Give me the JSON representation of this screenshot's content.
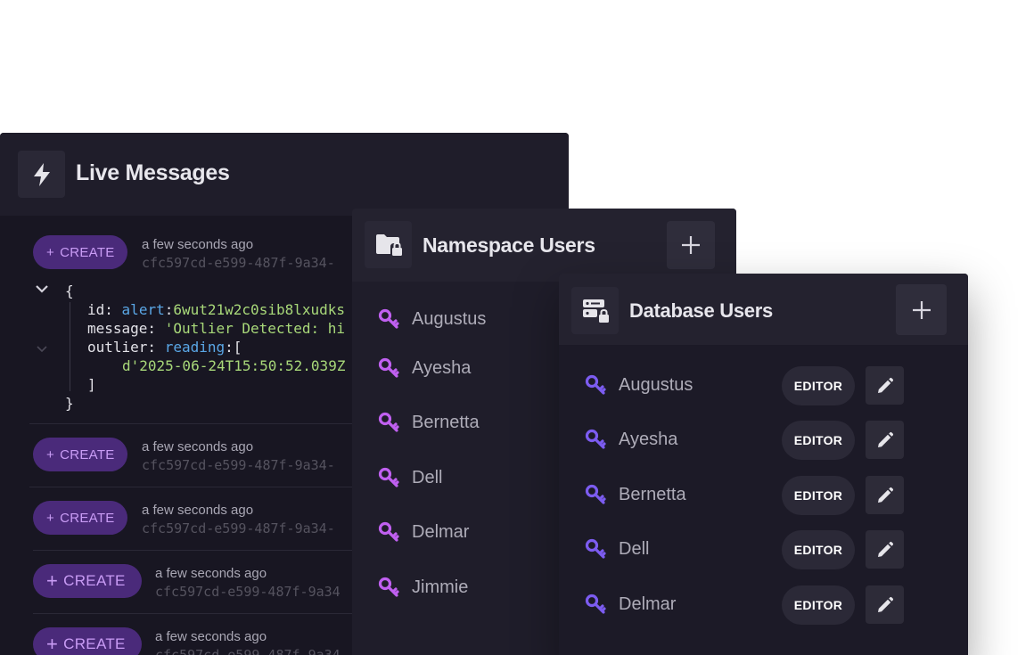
{
  "live": {
    "title": "Live Messages",
    "icon": "lightning-icon",
    "messages": [
      {
        "action": "CREATE",
        "time": "a few seconds ago",
        "id": "cfc597cd-e599-487f-9a34-"
      },
      {
        "action": "CREATE",
        "time": "a few seconds ago",
        "id": "cfc597cd-e599-487f-9a34-"
      },
      {
        "action": "CREATE",
        "time": "a few seconds ago",
        "id": "cfc597cd-e599-487f-9a34-"
      },
      {
        "action": "CREATE",
        "time": "a few seconds ago",
        "id": "cfc597cd-e599-487f-9a34"
      },
      {
        "action": "CREATE",
        "time": "a few seconds ago",
        "id": "cfc597cd-e599-487f-9a34"
      }
    ],
    "payload": {
      "open_brace": "{",
      "id_key": "id:",
      "id_table": "alert",
      "id_colon": ":",
      "id_value": "6wut21w2c0sib8lxudks",
      "message_key": "message:",
      "message_value": "'Outlier Detected: hi",
      "outlier_key": "outlier:",
      "outlier_table": "reading",
      "outlier_open": ":[",
      "outlier_value": "d'2025-06-24T15:50:52.039Z",
      "close_bracket": "]",
      "close_brace": "}"
    }
  },
  "namespace": {
    "title": "Namespace Users",
    "icon": "folder-lock-icon",
    "add_icon": "plus-icon",
    "users": [
      "Augustus",
      "Ayesha",
      "Bernetta",
      "Dell",
      "Delmar",
      "Jimmie"
    ]
  },
  "database": {
    "title": "Database Users",
    "icon": "database-lock-icon",
    "add_icon": "plus-icon",
    "users": [
      {
        "name": "Augustus",
        "role": "EDITOR"
      },
      {
        "name": "Ayesha",
        "role": "EDITOR"
      },
      {
        "name": "Bernetta",
        "role": "EDITOR"
      },
      {
        "name": "Dell",
        "role": "EDITOR"
      },
      {
        "name": "Delmar",
        "role": "EDITOR"
      }
    ]
  },
  "colors": {
    "accent_purple": "#a855f7",
    "db_key": "#7c5cf0",
    "ns_key": "#c060f0",
    "panel_bg": "#1d1b27"
  }
}
